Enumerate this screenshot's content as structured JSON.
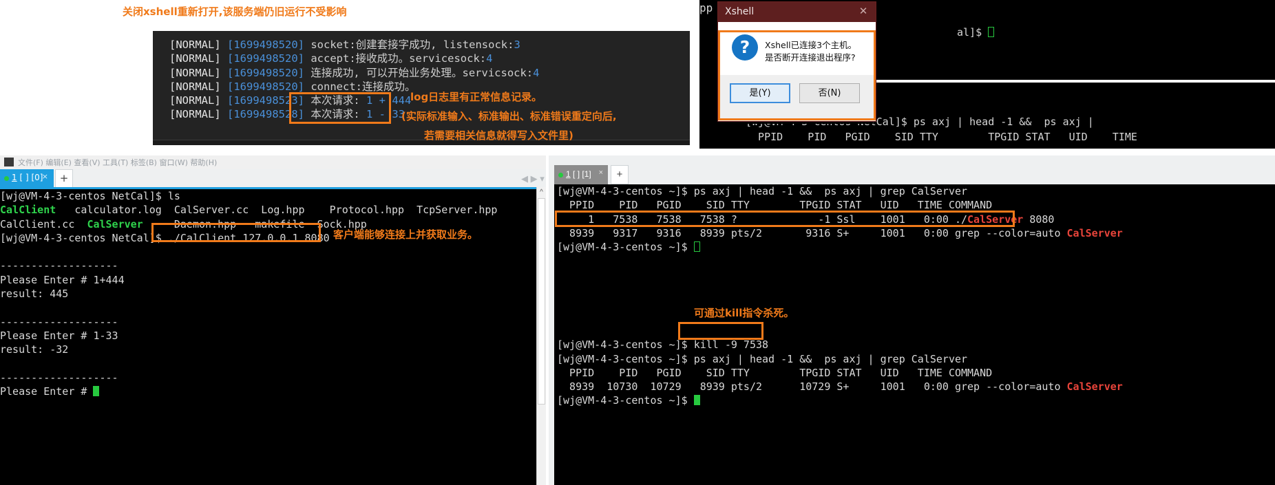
{
  "log_window": {
    "lines": [
      {
        "tag": "[NORMAL]",
        "ts": "[1699498520]",
        "msg": "socket:创建套接字成功, listensock:",
        "num": "3"
      },
      {
        "tag": "[NORMAL]",
        "ts": "[1699498520]",
        "msg": "accept:接收成功。servicesock:",
        "num": "4"
      },
      {
        "tag": "[NORMAL]",
        "ts": "[1699498520]",
        "msg": "连接成功, 可以开始业务处理。servicsock:",
        "num": "4"
      },
      {
        "tag": "[NORMAL]",
        "ts": "[1699498520]",
        "msg": "connect:连接成功。",
        "num": ""
      },
      {
        "tag": "[NORMAL]",
        "ts": "[1699498523]",
        "msg": "本次请求: ",
        "num": "1 + 444"
      },
      {
        "tag": "[NORMAL]",
        "ts": "[1699498528]",
        "msg": "本次请求: ",
        "num": "1 - 33"
      }
    ]
  },
  "annotations": {
    "log_1": "log日志里有正常信息记录。",
    "log_2": "(实际标准输入、标准输出、标准错误重定向后,",
    "log_3": "若需要相关信息就得写入文件里)",
    "left_client": "客户端能够连接上并获取业务。",
    "right_restart": "关闭xshell重新打开,该服务端仍旧运行不受影响",
    "kill": "可通过kill指令杀死。"
  },
  "dialog": {
    "title": "Xshell",
    "close_icon": "✕",
    "question_icon": "?",
    "message_line1": "Xshell已连接3个主机。",
    "message_line2": "是否断开连接退出程序?",
    "yes_label": "是(Y)",
    "no_label": "否(N)"
  },
  "background_terminal": {
    "app_text": "pp",
    "line_right": "al]$ ",
    "line_1": "[wj@VM-4-3-centos NetCal]$ ps axj | head -1 &&  ps axj |",
    "line_2": "  PPID    PID   PGID    SID TTY        TPGID STAT   UID    TIME",
    "line_3_pid": "   PPID"
  },
  "left_window": {
    "menubar_text": "文件(F)  编辑(E)  查看(V)  工具(T)  标签(B)  窗口(W)  帮助(H)",
    "tab": {
      "label_num": "1",
      "label_rest": "[ ] [0]",
      "close": "×"
    },
    "plus": "+",
    "scroll_up": "^",
    "lines": [
      {
        "type": "plain",
        "text": "[wj@VM-4-3-centos NetCal]$ ls"
      },
      {
        "type": "ls1"
      },
      {
        "type": "ls2"
      },
      {
        "type": "cmd",
        "prompt": "[wj@VM-4-3-centos NetCal]$ ",
        "cmd": "./CalClient 127.0.0.1 8080"
      },
      {
        "type": "plain",
        "text": ""
      },
      {
        "type": "plain",
        "text": "-------------------"
      },
      {
        "type": "plain",
        "text": "Please Enter # 1+444"
      },
      {
        "type": "plain",
        "text": "result: 445"
      },
      {
        "type": "plain",
        "text": ""
      },
      {
        "type": "plain",
        "text": "-------------------"
      },
      {
        "type": "plain",
        "text": "Please Enter # 1-33"
      },
      {
        "type": "plain",
        "text": "result: -32"
      },
      {
        "type": "plain",
        "text": ""
      },
      {
        "type": "plain",
        "text": "-------------------"
      },
      {
        "type": "prompt_cursor",
        "text": "Please Enter # "
      }
    ],
    "ls_row1": {
      "a": "CalClient",
      "b": "   calculator.log  CalServer.cc  Log.hpp    Protocol.hpp  TcpServer.hpp"
    },
    "ls_row2": {
      "a": "CalClient.cc  ",
      "b": "CalServer",
      "c": "     Daemon.hpp   makefile  Sock.hpp"
    }
  },
  "right_window": {
    "nav_arrows": "◀ ▶   ▾",
    "tab": {
      "label_num": "1",
      "label_rest": "[ ] [1]",
      "close": "×"
    },
    "plus": "+",
    "lines": [
      {
        "type": "cmd",
        "prompt": "[wj@VM-4-3-centos ~]$ ",
        "cmd": "ps axj | head -1 &&  ps axj | grep CalServer"
      },
      {
        "type": "plain",
        "text": "  PPID    PID   PGID    SID TTY        TPGID STAT   UID   TIME COMMAND"
      },
      {
        "type": "proc_server",
        "pre": "     1   7538   7538   7538 ?             -1 Ssl    1001   0:00 ./",
        "name": "CalServer",
        "post": " 8080"
      },
      {
        "type": "proc_grep",
        "pre": "  8939   9317   9316   8939 pts/2       9316 S+     1001   0:00 grep --color=auto ",
        "name": "CalServer"
      },
      {
        "type": "prompt_cursor",
        "text": "[wj@VM-4-3-centos ~]$ "
      },
      {
        "type": "plain",
        "text": ""
      },
      {
        "type": "plain",
        "text": ""
      },
      {
        "type": "plain",
        "text": ""
      },
      {
        "type": "plain",
        "text": ""
      },
      {
        "type": "plain",
        "text": ""
      },
      {
        "type": "plain",
        "text": ""
      },
      {
        "type": "cmd",
        "prompt": "[wj@VM-4-3-centos ~]$ ",
        "cmd": "kill -9 7538"
      },
      {
        "type": "cmd",
        "prompt": "[wj@VM-4-3-centos ~]$ ",
        "cmd": "ps axj | head -1 &&  ps axj | grep CalServer"
      },
      {
        "type": "plain",
        "text": "  PPID    PID   PGID    SID TTY        TPGID STAT   UID   TIME COMMAND"
      },
      {
        "type": "proc_grep",
        "pre": "  8939  10730  10729   8939 pts/2      10729 S+     1001   0:00 grep --color=auto ",
        "name": "CalServer"
      },
      {
        "type": "prompt_cursor_green",
        "text": "[wj@VM-4-3-centos ~]$ "
      }
    ]
  },
  "colors": {
    "accent_orange": "#f07a1a",
    "tab_active_blue": "#1e9fe0",
    "terminal_green": "#2fd34c",
    "terminal_red": "#e8443a",
    "log_blue": "#4a90d9",
    "dialog_title_bg": "#5e1f1f"
  }
}
